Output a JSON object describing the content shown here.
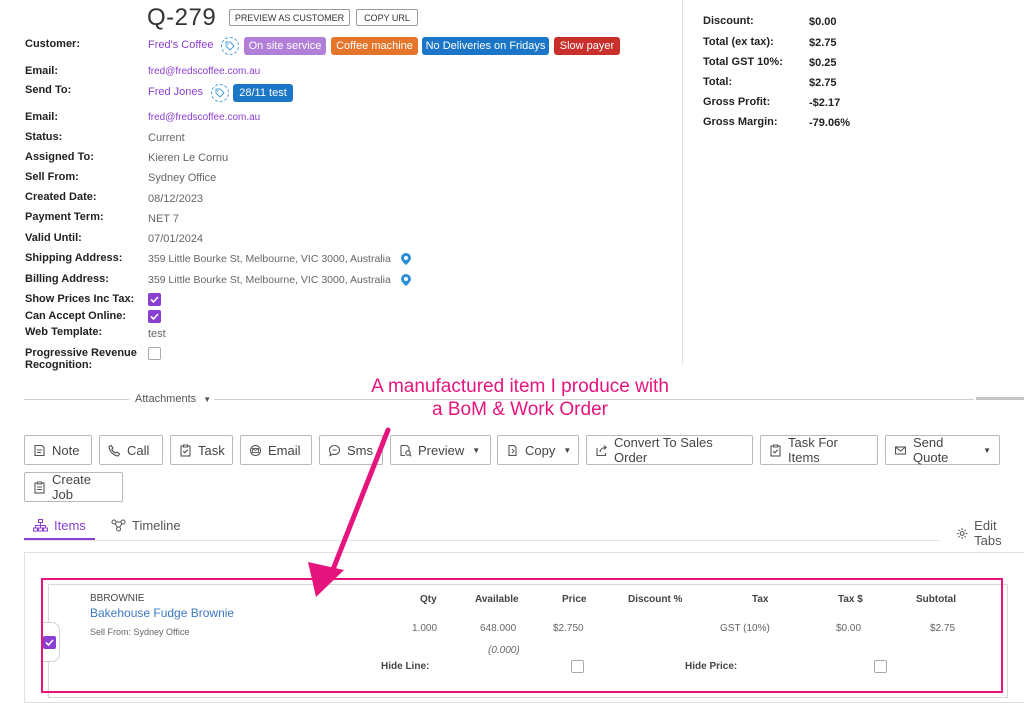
{
  "header": {
    "quote_number": "Q-279",
    "preview_label": "PREVIEW AS CUSTOMER",
    "copy_url_label": "COPY URL"
  },
  "details": {
    "customer_label": "Customer:",
    "customer_value": "Fred's Coffee",
    "tags": [
      {
        "label": "On site service",
        "color": "#b27fd8"
      },
      {
        "label": "Coffee machine",
        "color": "#e4752b"
      },
      {
        "label": "No Deliveries on Fridays",
        "color": "#1b76c7"
      },
      {
        "label": "Slow payer",
        "color": "#c9302c"
      }
    ],
    "email_label": "Email:",
    "email_value": "fred@fredscoffee.com.au",
    "send_to_label": "Send To:",
    "send_to_value": "Fred Jones",
    "send_to_tag": {
      "label": "28/11 test",
      "color": "#1b76c7"
    },
    "email2_label": "Email:",
    "email2_value": "fred@fredscoffee.com.au",
    "status_label": "Status:",
    "status_value": "Current",
    "assigned_label": "Assigned To:",
    "assigned_value": "Kieren Le Cornu",
    "sell_from_label": "Sell From:",
    "sell_from_value": "Sydney Office",
    "created_label": "Created Date:",
    "created_value": "08/12/2023",
    "payment_label": "Payment Term:",
    "payment_value": "NET 7",
    "valid_label": "Valid Until:",
    "valid_value": "07/01/2024",
    "shipping_label": "Shipping Address:",
    "shipping_value": "359 Little Bourke St, Melbourne, VIC 3000, Australia",
    "billing_label": "Billing Address:",
    "billing_value": "359 Little Bourke St, Melbourne, VIC 3000, Australia",
    "show_prices_label": "Show Prices Inc Tax:",
    "show_prices_checked": true,
    "accept_online_label": "Can Accept Online:",
    "accept_online_checked": true,
    "web_template_label": "Web Template:",
    "web_template_value": "test",
    "progressive_label_1": "Progressive Revenue",
    "progressive_label_2": "Recognition:",
    "progressive_checked": false
  },
  "summary": {
    "discount_label": "Discount:",
    "discount_value": "$0.00",
    "total_ex_label": "Total (ex tax):",
    "total_ex_value": "$2.75",
    "gst_label": "Total GST 10%:",
    "gst_value": "$0.25",
    "total_label": "Total:",
    "total_value": "$2.75",
    "gross_profit_label": "Gross Profit:",
    "gross_profit_value": "-$2.17",
    "gross_margin_label": "Gross Margin:",
    "gross_margin_value": "-79.06%"
  },
  "attachments_label": "Attachments",
  "toolbar": {
    "note": "Note",
    "call": "Call",
    "task": "Task",
    "email": "Email",
    "sms": "Sms",
    "preview": "Preview",
    "copy": "Copy",
    "convert": "Convert To Sales Order",
    "task_items": "Task For Items",
    "send_quote": "Send Quote",
    "create_job": "Create Job"
  },
  "tabs": {
    "items": "Items",
    "timeline": "Timeline",
    "edit_tabs": "Edit Tabs"
  },
  "item_columns": {
    "qty": "Qty",
    "available": "Available",
    "price": "Price",
    "discount": "Discount %",
    "tax": "Tax",
    "tax_dollar": "Tax $",
    "subtotal": "Subtotal"
  },
  "item": {
    "sku": "BBROWNIE",
    "name": "Bakehouse Fudge Brownie",
    "sell_from": "Sell From: Sydney Office",
    "qty": "1.000",
    "available": "648.000",
    "available_sub": "(0.000)",
    "price": "$2.750",
    "tax": "GST (10%)",
    "tax_dollar": "$0.00",
    "subtotal": "$2.75",
    "hide_line_label": "Hide Line:",
    "hide_price_label": "Hide Price:"
  },
  "annotation": {
    "line1": "A manufactured item I produce with",
    "line2": "a BoM & Work Order",
    "color": "#e6157e"
  }
}
